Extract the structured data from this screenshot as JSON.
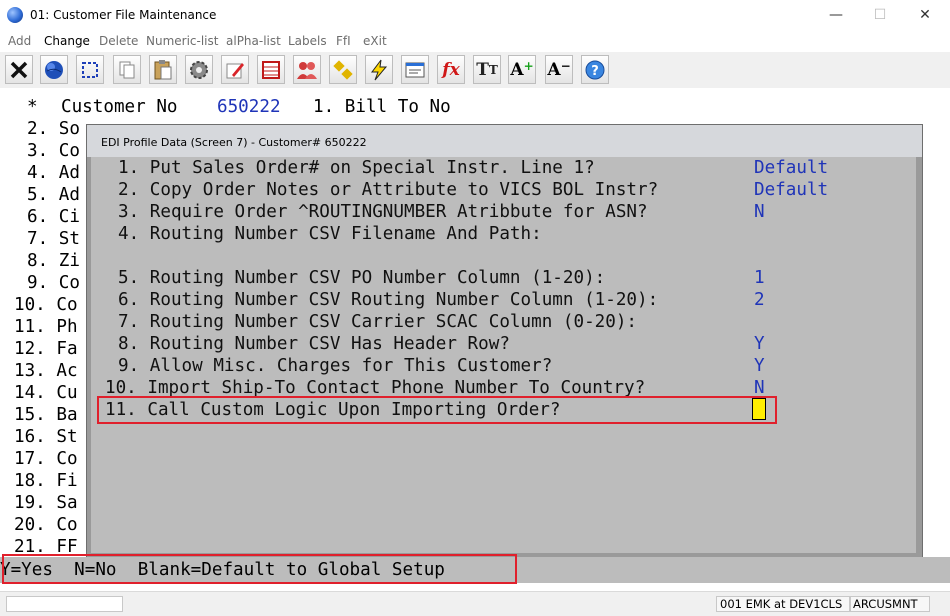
{
  "window": {
    "title": "01: Customer File Maintenance",
    "min_glyph": "—",
    "max_glyph": "☐",
    "close_glyph": "✕"
  },
  "menu": [
    "Add",
    "Change",
    "Delete",
    "Numeric-list",
    "alPha-list",
    "Labels",
    "FfI",
    "eXit"
  ],
  "menu_active": "Change",
  "toolbar": [
    "close-icon",
    "globe-icon",
    "select-icon",
    "copy-icon",
    "paste-icon",
    "settings-icon",
    "edit-icon",
    "table-icon",
    "users-icon",
    "link-icon",
    "lightning-icon",
    "document-icon",
    "function-icon",
    "font-icon",
    "increase-font-icon",
    "decrease-font-icon",
    "help-icon"
  ],
  "background": {
    "header": {
      "star": "*",
      "customer_label": "Customer No",
      "customer_no": "650222",
      "bill_to": "1. Bill To No"
    },
    "lines": [
      "2. So",
      "3. Co",
      "4. Ad",
      "5. Ad",
      "6. Ci",
      "7. St",
      "8. Zi",
      "9. Co",
      "10. Co",
      "11. Ph",
      "12. Fa",
      "13. Ac",
      "14. Cu",
      "15. Ba",
      "16. St",
      "17. Co",
      "18. Fi",
      "19. Sa",
      "20. Co",
      "21. FF"
    ]
  },
  "dialog": {
    "title": "EDI Profile Data (Screen 7) - Customer# 650222",
    "items": [
      {
        "label": "1. Put Sales Order# on Special Instr. Line 1?",
        "value": "Default"
      },
      {
        "label": "2. Copy Order Notes or Attribute to VICS BOL Instr?",
        "value": "Default"
      },
      {
        "label": "3. Require Order ^ROUTINGNUMBER Atribbute for ASN?",
        "value": "N"
      },
      {
        "label": "4. Routing Number CSV Filename And Path:",
        "value": ""
      },
      {
        "label": "5. Routing Number CSV PO Number Column (1-20):",
        "value": "1"
      },
      {
        "label": "6. Routing Number CSV Routing Number Column (1-20):",
        "value": "2"
      },
      {
        "label": "7. Routing Number CSV Carrier SCAC Column (0-20):",
        "value": ""
      },
      {
        "label": "8. Routing Number CSV Has Header Row?",
        "value": "Y"
      },
      {
        "label": "9. Allow Misc. Charges for This Customer?",
        "value": "Y"
      },
      {
        "label": "10. Import Ship-To Contact Phone Number To Country?",
        "value": "N"
      },
      {
        "label": "11. Call Custom Logic Upon Importing Order?",
        "value": ""
      }
    ]
  },
  "prompt": "Y=Yes  N=No  Blank=Default to Global Setup",
  "status": {
    "session": "001 EMK at DEV1CLS",
    "program": "ARCUSMNT"
  },
  "colors": {
    "value_blue": "#1f34b8",
    "highlight_red": "#e0202c",
    "cursor_yellow": "#ffee00",
    "dialog_gray": "#bcbcbc"
  }
}
